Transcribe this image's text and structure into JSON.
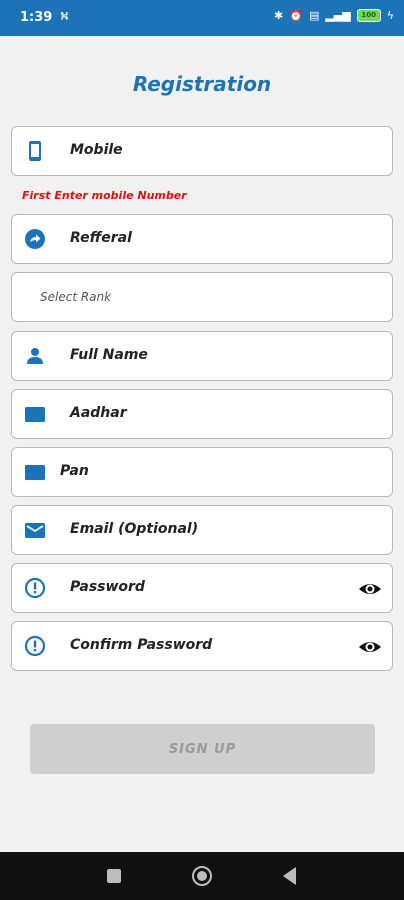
{
  "status_bar": {
    "time": "1:39",
    "battery": "100"
  },
  "page": {
    "title": "Registration"
  },
  "form": {
    "mobile_label": "Mobile",
    "mobile_error": "First Enter mobile Number",
    "referral_label": "Refferal",
    "rank_placeholder": "Select Rank",
    "fullname_label": "Full Name",
    "aadhar_label": "Aadhar",
    "pan_label": "Pan",
    "email_label": "Email (Optional)",
    "password_label": "Password",
    "confirm_password_label": "Confirm Password"
  },
  "actions": {
    "signup_label": "SIGN UP"
  },
  "colors": {
    "accent": "#1c73b8",
    "error": "#e01010",
    "button_disabled": "#cfcfcf"
  },
  "icons": {
    "mobile": "phone-icon",
    "referral": "share-icon",
    "fullname": "person-icon",
    "aadhar": "card-icon",
    "pan": "card-icon",
    "email": "mail-icon",
    "password": "info-icon",
    "visibility": "eye-icon"
  }
}
